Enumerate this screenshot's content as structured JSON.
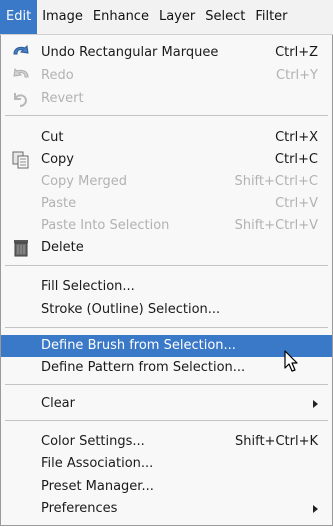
{
  "menubar": {
    "items": [
      "Edit",
      "Image",
      "Enhance",
      "Layer",
      "Select",
      "Filter"
    ]
  },
  "menu": {
    "undo": {
      "label": "Undo Rectangular Marquee",
      "shortcut": "Ctrl+Z"
    },
    "redo": {
      "label": "Redo",
      "shortcut": "Ctrl+Y"
    },
    "revert": {
      "label": "Revert"
    },
    "cut": {
      "label": "Cut",
      "shortcut": "Ctrl+X"
    },
    "copy": {
      "label": "Copy",
      "shortcut": "Ctrl+C"
    },
    "copy_merged": {
      "label": "Copy Merged",
      "shortcut": "Shift+Ctrl+C"
    },
    "paste": {
      "label": "Paste",
      "shortcut": "Ctrl+V"
    },
    "paste_into": {
      "label": "Paste Into Selection",
      "shortcut": "Shift+Ctrl+V"
    },
    "delete": {
      "label": "Delete"
    },
    "fill": {
      "label": "Fill Selection..."
    },
    "stroke": {
      "label": "Stroke (Outline) Selection..."
    },
    "define_brush": {
      "label": "Define Brush from Selection..."
    },
    "define_pattern": {
      "label": "Define Pattern from Selection..."
    },
    "clear": {
      "label": "Clear"
    },
    "color_settings": {
      "label": "Color Settings...",
      "shortcut": "Shift+Ctrl+K"
    },
    "file_association": {
      "label": "File Association..."
    },
    "preset_manager": {
      "label": "Preset Manager..."
    },
    "preferences": {
      "label": "Preferences"
    }
  },
  "colors": {
    "highlight": "#3a78c8",
    "disabled_text": "#b2b2b2"
  }
}
